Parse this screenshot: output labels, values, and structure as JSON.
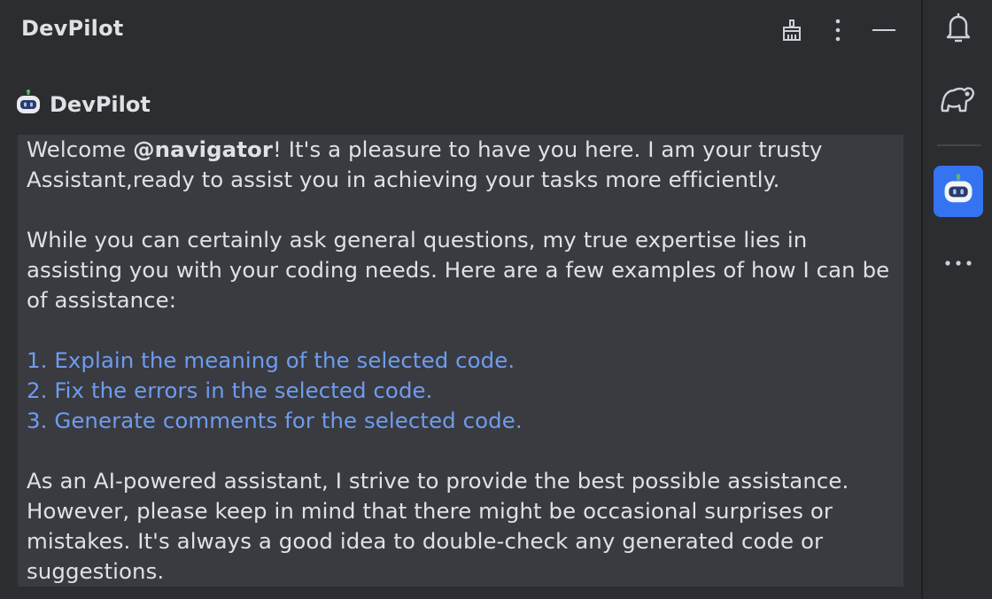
{
  "panel": {
    "title": "DevPilot",
    "header_buttons": {
      "clear_icon": "broom-icon",
      "options_icon": "more-vertical-icon",
      "minimize_icon": "minimize-icon"
    }
  },
  "message": {
    "author": "DevPilot",
    "avatar_icon": "robot-icon",
    "greeting_before": "Welcome ",
    "mention": "@navigator",
    "greeting_after": "! It's a pleasure to have you here. I am your trusty Assistant,ready to assist you in achieving your tasks more efficiently.",
    "intro": "While you can certainly ask general questions, my true expertise lies in assisting you with your coding needs. Here are a few examples of how I can be of assistance:",
    "examples": [
      "1. Explain the meaning of the selected code.",
      "2. Fix the errors in the selected code.",
      "3. Generate comments for the selected code."
    ],
    "disclaimer": "As an AI-powered assistant, I strive to provide the best possible assistance. However, please keep in mind that there might be occasional surprises or mistakes. It's always a good idea to double-check any generated code or suggestions."
  },
  "sidebar": {
    "items": [
      {
        "icon": "bell-icon",
        "active": false
      },
      {
        "icon": "gradle-elephant-icon",
        "active": false
      },
      {
        "icon": "robot-icon",
        "active": true
      },
      {
        "icon": "more-horizontal-icon",
        "active": false
      }
    ]
  },
  "colors": {
    "background": "#2b2d30",
    "message_background": "#393b40",
    "text": "#dfe1e5",
    "link": "#6f9cef",
    "accent": "#3574f0"
  }
}
